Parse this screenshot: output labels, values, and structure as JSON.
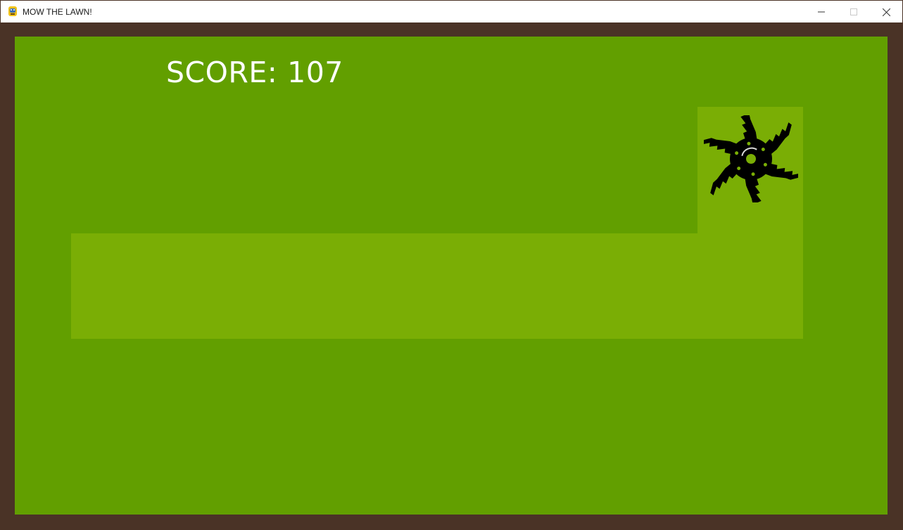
{
  "window": {
    "title": "MOW THE LAWN!",
    "icon": "pygame-snake-icon",
    "controls": [
      "minimize-icon",
      "maximize-icon",
      "close-icon"
    ]
  },
  "game": {
    "score_label": "SCORE:",
    "score_value": "107",
    "colors": {
      "frame": "#4a3326",
      "uncut_grass": "#629f00",
      "mowed_grass": "#7aae05",
      "score_text": "#ffffff",
      "mower_blade": "#000000"
    },
    "mower_icon": "spinning-blade-icon"
  }
}
